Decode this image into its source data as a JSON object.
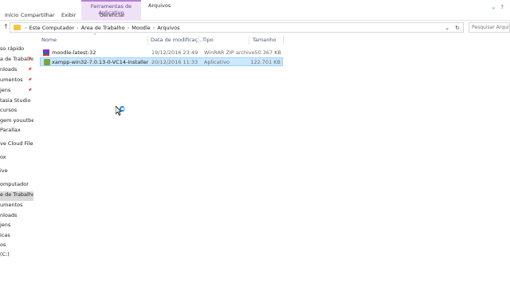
{
  "ribbon": {
    "tabs": [
      "Início",
      "Compartilhar",
      "Exibir"
    ],
    "tool_group_title": "Ferramentas de Aplicativo",
    "tool_tab": "Gerenciar",
    "context_tab": "Arquivos"
  },
  "address": {
    "crumbs": [
      "Este Computador",
      "Área de Trabalho",
      "Moodle",
      "Arquivos"
    ],
    "search_placeholder": "Pesquisar Arquivos"
  },
  "sidebar": {
    "items": [
      {
        "label": "so rápido",
        "pinned": false
      },
      {
        "label": "a de Trabalho",
        "pinned": true
      },
      {
        "label": "nloads",
        "pinned": true
      },
      {
        "label": "umentos",
        "pinned": true
      },
      {
        "label": "jens",
        "pinned": true
      },
      {
        "label": "tasia Studio",
        "pinned": false
      },
      {
        "label": "cursos",
        "pinned": false
      },
      {
        "label": "gem youutbe",
        "pinned": false
      },
      {
        "label": "Parallax",
        "pinned": false
      },
      {
        "label": "ve Cloud Files",
        "pinned": false
      },
      {
        "label": "ox",
        "pinned": false
      },
      {
        "label": "ive",
        "pinned": false
      },
      {
        "label": "omputador",
        "pinned": false
      },
      {
        "label": "e de Trabalho",
        "pinned": false
      },
      {
        "label": "umentos",
        "pinned": false
      },
      {
        "label": "nloads",
        "pinned": false
      },
      {
        "label": "jens",
        "pinned": false
      },
      {
        "label": "icas",
        "pinned": false
      },
      {
        "label": "os",
        "pinned": false
      },
      {
        "label": "(C:)",
        "pinned": false
      }
    ]
  },
  "columns": [
    "Nome",
    "Data de modificaç...",
    "Tipo",
    "Tamanho"
  ],
  "files": [
    {
      "name": "moodle-latest-32",
      "date": "19/12/2016 23:49",
      "type": "WinRAR ZIP archive",
      "size": "50.367 KB",
      "icon": "winrar-zip-icon"
    },
    {
      "name": "xampp-win32-7.0.13-0-VC14-installer",
      "date": "20/12/2016 11:33",
      "type": "Aplicativo",
      "size": "122.701 KB",
      "icon": "xampp-installer-icon"
    }
  ],
  "colors": {
    "selection": "#cce8ff",
    "tool_group": "#efe2f7",
    "accent": "#1f6fd1"
  }
}
